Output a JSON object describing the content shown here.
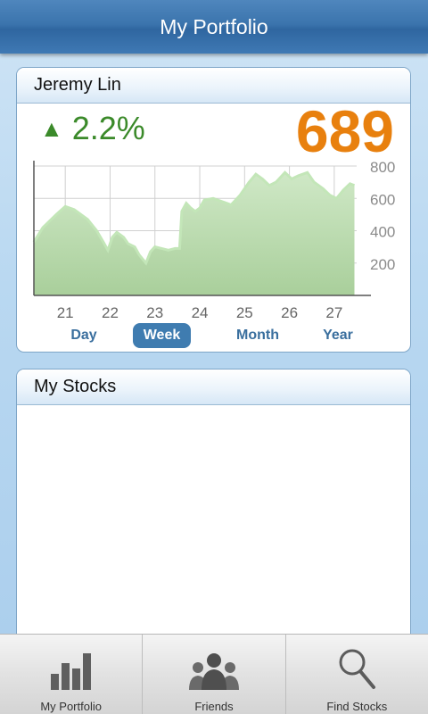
{
  "header": {
    "title": "My Portfolio"
  },
  "portfolio": {
    "user_name": "Jeremy Lin",
    "change_icon": "up-triangle-icon",
    "change_text": "2.2%",
    "value_text": "689",
    "colors": {
      "up": "#3b8a2a",
      "value": "#e8800e",
      "accent": "#3f7cb0"
    }
  },
  "chart_data": {
    "type": "area",
    "x_ticks": [
      "21",
      "22",
      "23",
      "24",
      "25",
      "26",
      "27"
    ],
    "y_ticks": [
      "800",
      "600",
      "400",
      "200"
    ],
    "ylim": [
      0,
      800
    ],
    "xlim": [
      20.3,
      27.5
    ],
    "grid": true,
    "series": [
      {
        "x": [
          20.3,
          20.5,
          20.8,
          21.0,
          21.2,
          21.5,
          21.7,
          21.85,
          21.95,
          22.05,
          22.15,
          22.3,
          22.4,
          22.55,
          22.65,
          22.8,
          22.9,
          23.0,
          23.15,
          23.3,
          23.45,
          23.55,
          23.6,
          23.7,
          23.8,
          23.9,
          24.0,
          24.1,
          24.3,
          24.5,
          24.7,
          24.9,
          25.1,
          25.25,
          25.4,
          25.55,
          25.7,
          25.9,
          26.05,
          26.2,
          26.4,
          26.55,
          26.75,
          26.9,
          27.05,
          27.2,
          27.35,
          27.45
        ],
        "y": [
          330,
          420,
          500,
          550,
          530,
          470,
          400,
          330,
          280,
          360,
          390,
          360,
          320,
          300,
          250,
          200,
          270,
          300,
          290,
          280,
          290,
          290,
          520,
          570,
          540,
          520,
          540,
          590,
          600,
          580,
          560,
          620,
          700,
          750,
          720,
          680,
          700,
          760,
          720,
          740,
          760,
          700,
          660,
          620,
          600,
          650,
          690,
          680
        ]
      }
    ]
  },
  "ranges": {
    "items": [
      "Day",
      "Week",
      "Month",
      "Year"
    ],
    "active": "Week"
  },
  "stocks": {
    "title": "My Stocks"
  },
  "tabs": [
    {
      "label": "My Portfolio",
      "icon": "bar-chart-icon"
    },
    {
      "label": "Friends",
      "icon": "people-icon"
    },
    {
      "label": "Find Stocks",
      "icon": "magnifier-icon"
    }
  ]
}
